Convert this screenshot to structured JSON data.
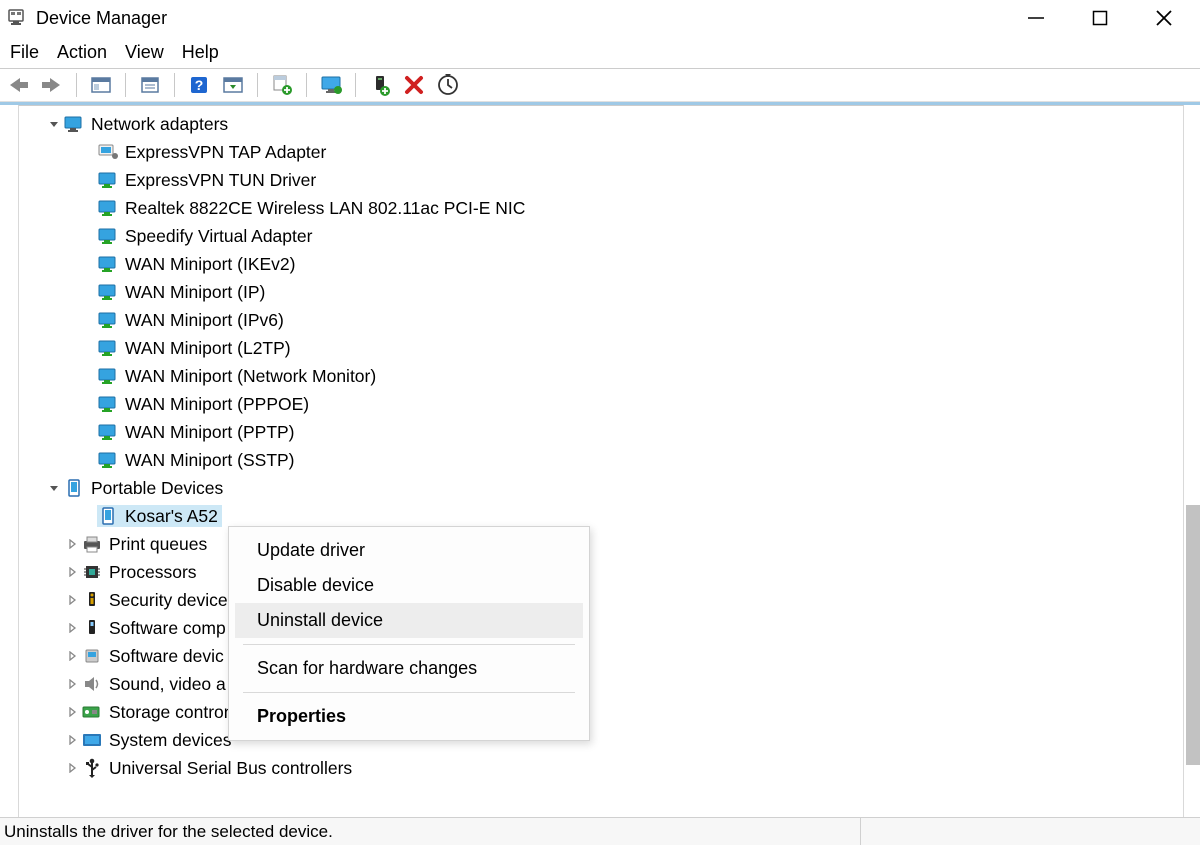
{
  "window": {
    "title": "Device Manager"
  },
  "menubar": {
    "file": "File",
    "action": "Action",
    "view": "View",
    "help": "Help"
  },
  "toolbar": {
    "back": "back-icon",
    "forward": "forward-icon",
    "show_hide": "show-hide-icon",
    "properties": "properties-window-icon",
    "help": "help-icon",
    "view_menu": "view-menu-icon",
    "update_driver": "update-driver-icon",
    "monitor": "monitor-action-icon",
    "add_hardware": "add-hardware-icon",
    "remove": "remove-icon",
    "scan": "scan-hardware-icon"
  },
  "tree": {
    "network_adapters": {
      "label": "Network adapters",
      "expanded": true,
      "items": [
        "ExpressVPN TAP Adapter",
        "ExpressVPN TUN Driver",
        "Realtek 8822CE Wireless LAN 802.11ac PCI-E NIC",
        "Speedify Virtual Adapter",
        "WAN Miniport (IKEv2)",
        "WAN Miniport (IP)",
        "WAN Miniport (IPv6)",
        "WAN Miniport (L2TP)",
        "WAN Miniport (Network Monitor)",
        "WAN Miniport (PPPOE)",
        "WAN Miniport (PPTP)",
        "WAN Miniport (SSTP)"
      ]
    },
    "portable_devices": {
      "label": "Portable Devices",
      "expanded": true,
      "items": [
        "Kosar's A52"
      ]
    },
    "print_queues": {
      "label": "Print queues"
    },
    "processors": {
      "label": "Processors"
    },
    "security_devices": {
      "label": "Security device"
    },
    "software_components": {
      "label": "Software comp"
    },
    "software_devices": {
      "label": "Software devic"
    },
    "sound": {
      "label": "Sound, video a"
    },
    "storage_controllers": {
      "label": "Storage controners"
    },
    "system_devices": {
      "label": "System devices"
    },
    "usb_controllers": {
      "label": "Universal Serial Bus controllers"
    }
  },
  "context_menu": {
    "update_driver": "Update driver",
    "disable_device": "Disable device",
    "uninstall_device": "Uninstall device",
    "scan": "Scan for hardware changes",
    "properties": "Properties"
  },
  "statusbar": {
    "text": "Uninstalls the driver for the selected device."
  }
}
